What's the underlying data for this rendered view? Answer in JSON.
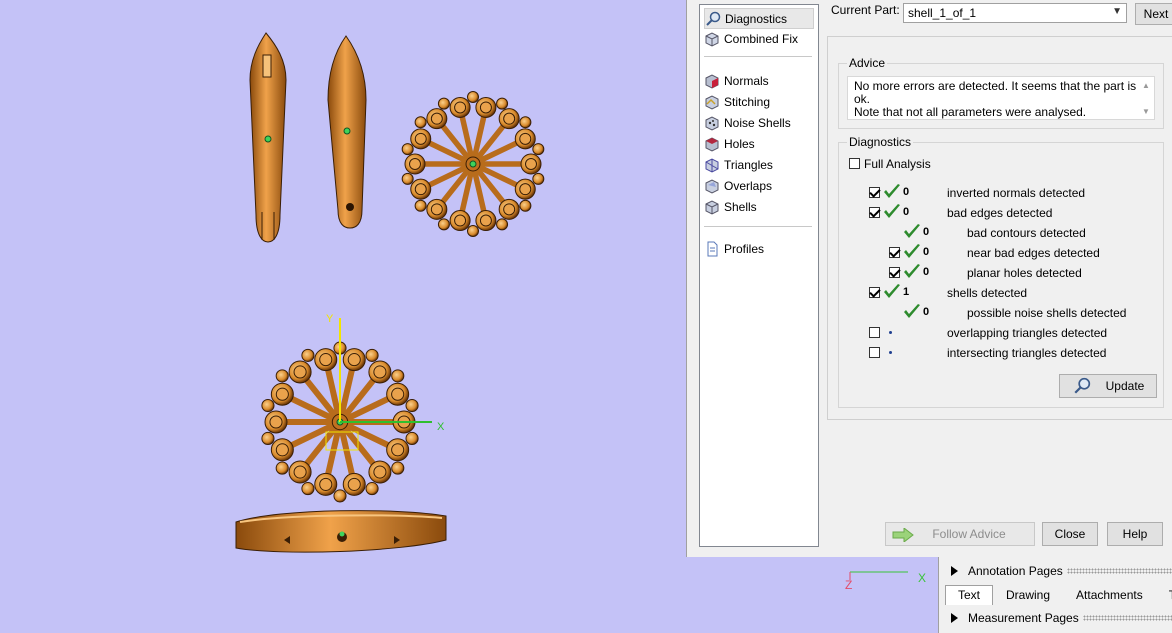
{
  "dialog": {
    "nav_items": [
      {
        "label": "Diagnostics",
        "icon": "magnifier-icon",
        "selected": true
      },
      {
        "label": "Combined Fix",
        "icon": "cube-icon"
      },
      {
        "label": "Normals",
        "icon": "normals-icon"
      },
      {
        "label": "Stitching",
        "icon": "stitching-icon"
      },
      {
        "label": "Noise Shells",
        "icon": "noise-shells-icon"
      },
      {
        "label": "Holes",
        "icon": "holes-icon"
      },
      {
        "label": "Triangles",
        "icon": "triangles-icon"
      },
      {
        "label": "Overlaps",
        "icon": "overlaps-icon"
      },
      {
        "label": "Shells",
        "icon": "shells-icon"
      },
      {
        "label": "Profiles",
        "icon": "document-icon"
      }
    ],
    "current_part_label": "Current Part:",
    "current_part_value": "shell_1_of_1",
    "next_label": "Next",
    "advice": {
      "title": "Advice",
      "line1": "No more errors are detected. It seems that the part is ok.",
      "line2": "Note that not all parameters were analysed."
    },
    "diagnostics": {
      "title": "Diagnostics",
      "full_analysis_label": "Full Analysis",
      "full_analysis_checked": false,
      "rows": [
        {
          "label": "inverted normals detected",
          "count": "0",
          "checked": true,
          "status": "ok"
        },
        {
          "label": "bad edges detected",
          "count": "0",
          "checked": true,
          "status": "ok"
        },
        {
          "label": "bad contours detected",
          "count": "0",
          "status": "ok"
        },
        {
          "label": "near bad edges detected",
          "count": "0",
          "checked": true,
          "status": "ok"
        },
        {
          "label": "planar holes detected",
          "count": "0",
          "checked": true,
          "status": "ok"
        },
        {
          "label": "shells detected",
          "count": "1",
          "checked": true,
          "status": "ok"
        },
        {
          "label": "possible noise shells detected",
          "count": "0",
          "status": "ok"
        },
        {
          "label": "overlapping triangles detected",
          "count": "",
          "checked": false,
          "status": "pending"
        },
        {
          "label": "intersecting triangles detected",
          "count": "",
          "checked": false,
          "status": "pending"
        }
      ],
      "update_label": "Update"
    },
    "follow_advice_label": "Follow Advice",
    "close_label": "Close",
    "help_label": "Help"
  },
  "bottom_panel": {
    "annotation_pages_label": "Annotation Pages",
    "tabs": [
      "Text",
      "Drawing",
      "Attachments",
      "Te"
    ],
    "active_tab": "Text",
    "measurement_pages_label": "Measurement Pages"
  },
  "viewport": {
    "axis_labels": {
      "y": "Y",
      "x": "X",
      "z": "Z",
      "xx": "X"
    },
    "background": "#c4c2f7",
    "accent_gold": "#d98a2b"
  }
}
